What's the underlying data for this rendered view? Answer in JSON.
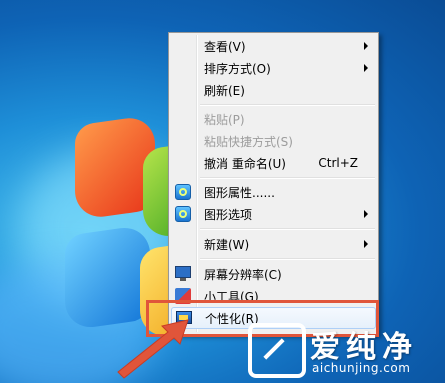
{
  "menu": {
    "items": [
      {
        "label": "查看(V)",
        "submenu": true,
        "disabled": false,
        "icon": null
      },
      {
        "label": "排序方式(O)",
        "submenu": true,
        "disabled": false,
        "icon": null
      },
      {
        "label": "刷新(E)",
        "submenu": false,
        "disabled": false,
        "icon": null
      },
      {
        "label": "粘贴(P)",
        "submenu": false,
        "disabled": true,
        "icon": null
      },
      {
        "label": "粘贴快捷方式(S)",
        "submenu": false,
        "disabled": true,
        "icon": null
      },
      {
        "label": "撤消 重命名(U)",
        "shortcut": "Ctrl+Z",
        "submenu": false,
        "disabled": false,
        "icon": null
      },
      {
        "label": "图形属性......",
        "submenu": false,
        "disabled": false,
        "icon": "graphics-properties-icon"
      },
      {
        "label": "图形选项",
        "submenu": true,
        "disabled": false,
        "icon": "graphics-options-icon"
      },
      {
        "label": "新建(W)",
        "submenu": true,
        "disabled": false,
        "icon": null
      },
      {
        "label": "屏幕分辨率(C)",
        "submenu": false,
        "disabled": false,
        "icon": "monitor-icon"
      },
      {
        "label": "小工具(G)",
        "submenu": false,
        "disabled": false,
        "icon": "gadgets-icon"
      },
      {
        "label": "个性化(R)",
        "submenu": false,
        "disabled": false,
        "icon": "personalize-icon",
        "highlighted": true
      }
    ]
  },
  "watermark": {
    "title": "爱纯净",
    "url": "aichunjing.com"
  },
  "colors": {
    "highlight_frame": "#e0553a",
    "menu_background": "#f0f0f0",
    "disabled_text": "#9c9c9c"
  }
}
